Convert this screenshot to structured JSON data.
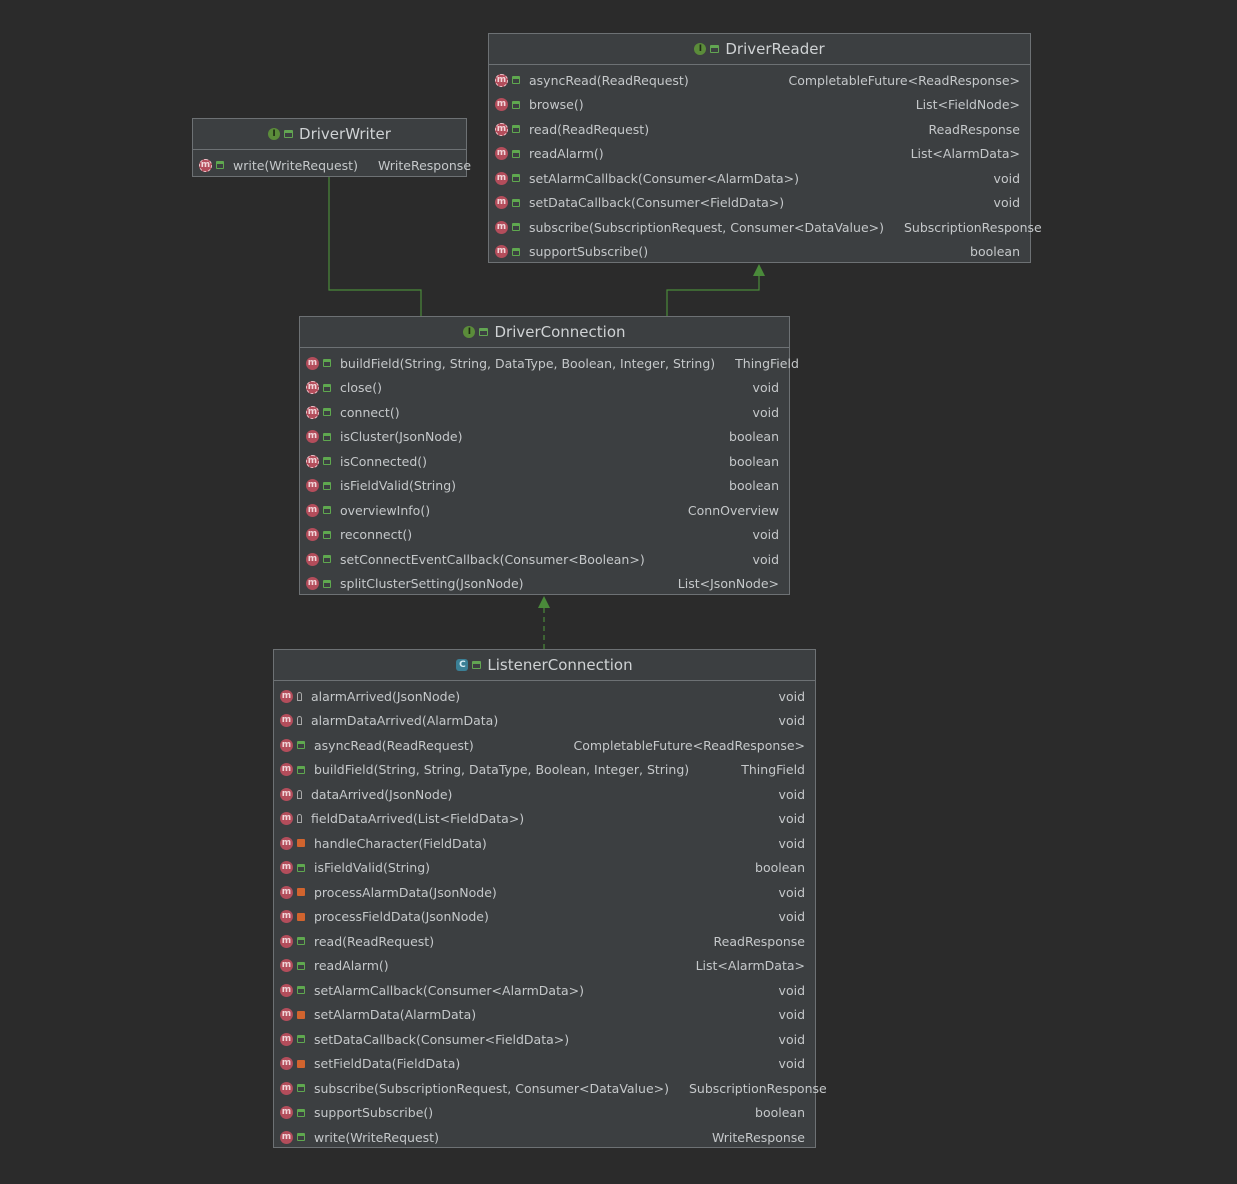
{
  "colors": {
    "background": "#2b2b2b",
    "box": "#3c3f41",
    "edge": "#4a8a3a",
    "method_icon": "#b34d5b",
    "interface_icon": "#5b8c3a",
    "class_icon": "#3a7f95"
  },
  "icons": {
    "interface": "I",
    "class": "C",
    "method": "m"
  },
  "driver_writer": {
    "title": "DriverWriter",
    "kind": "interface",
    "methods": [
      {
        "sig": "write(WriteRequest)",
        "ret": "WriteResponse",
        "vis": "public",
        "abstract": true
      }
    ]
  },
  "driver_reader": {
    "title": "DriverReader",
    "kind": "interface",
    "methods": [
      {
        "sig": "asyncRead(ReadRequest)",
        "ret": "CompletableFuture<ReadResponse>",
        "vis": "public",
        "abstract": true
      },
      {
        "sig": "browse()",
        "ret": "List<FieldNode>",
        "vis": "public",
        "abstract": false
      },
      {
        "sig": "read(ReadRequest)",
        "ret": "ReadResponse",
        "vis": "public",
        "abstract": true
      },
      {
        "sig": "readAlarm()",
        "ret": "List<AlarmData>",
        "vis": "public",
        "abstract": false
      },
      {
        "sig": "setAlarmCallback(Consumer<AlarmData>)",
        "ret": "void",
        "vis": "public",
        "abstract": false
      },
      {
        "sig": "setDataCallback(Consumer<FieldData>)",
        "ret": "void",
        "vis": "public",
        "abstract": false
      },
      {
        "sig": "subscribe(SubscriptionRequest, Consumer<DataValue>)",
        "ret": "SubscriptionResponse",
        "vis": "public",
        "abstract": false
      },
      {
        "sig": "supportSubscribe()",
        "ret": "boolean",
        "vis": "public",
        "abstract": false
      }
    ]
  },
  "driver_connection": {
    "title": "DriverConnection",
    "kind": "interface",
    "methods": [
      {
        "sig": "buildField(String, String, DataType, Boolean, Integer, String)",
        "ret": "ThingField",
        "vis": "public",
        "abstract": false
      },
      {
        "sig": "close()",
        "ret": "void",
        "vis": "public",
        "abstract": true
      },
      {
        "sig": "connect()",
        "ret": "void",
        "vis": "public",
        "abstract": true
      },
      {
        "sig": "isCluster(JsonNode)",
        "ret": "boolean",
        "vis": "public",
        "abstract": false
      },
      {
        "sig": "isConnected()",
        "ret": "boolean",
        "vis": "public",
        "abstract": true
      },
      {
        "sig": "isFieldValid(String)",
        "ret": "boolean",
        "vis": "public",
        "abstract": false
      },
      {
        "sig": "overviewInfo()",
        "ret": "ConnOverview",
        "vis": "public",
        "abstract": false
      },
      {
        "sig": "reconnect()",
        "ret": "void",
        "vis": "public",
        "abstract": false
      },
      {
        "sig": "setConnectEventCallback(Consumer<Boolean>)",
        "ret": "void",
        "vis": "public",
        "abstract": false
      },
      {
        "sig": "splitClusterSetting(JsonNode)",
        "ret": "List<JsonNode>",
        "vis": "public",
        "abstract": false
      }
    ]
  },
  "listener_connection": {
    "title": "ListenerConnection",
    "kind": "class",
    "methods": [
      {
        "sig": "alarmArrived(JsonNode)",
        "ret": "void",
        "vis": "protected",
        "abstract": false
      },
      {
        "sig": "alarmDataArrived(AlarmData)",
        "ret": "void",
        "vis": "protected",
        "abstract": false
      },
      {
        "sig": "asyncRead(ReadRequest)",
        "ret": "CompletableFuture<ReadResponse>",
        "vis": "public",
        "abstract": false
      },
      {
        "sig": "buildField(String, String, DataType, Boolean, Integer, String)",
        "ret": "ThingField",
        "vis": "public",
        "abstract": false
      },
      {
        "sig": "dataArrived(JsonNode)",
        "ret": "void",
        "vis": "protected",
        "abstract": false
      },
      {
        "sig": "fieldDataArrived(List<FieldData>)",
        "ret": "void",
        "vis": "protected",
        "abstract": false
      },
      {
        "sig": "handleCharacter(FieldData)",
        "ret": "void",
        "vis": "private",
        "abstract": false
      },
      {
        "sig": "isFieldValid(String)",
        "ret": "boolean",
        "vis": "public",
        "abstract": false
      },
      {
        "sig": "processAlarmData(JsonNode)",
        "ret": "void",
        "vis": "private",
        "abstract": false
      },
      {
        "sig": "processFieldData(JsonNode)",
        "ret": "void",
        "vis": "private",
        "abstract": false
      },
      {
        "sig": "read(ReadRequest)",
        "ret": "ReadResponse",
        "vis": "public",
        "abstract": false
      },
      {
        "sig": "readAlarm()",
        "ret": "List<AlarmData>",
        "vis": "public",
        "abstract": false
      },
      {
        "sig": "setAlarmCallback(Consumer<AlarmData>)",
        "ret": "void",
        "vis": "public",
        "abstract": false
      },
      {
        "sig": "setAlarmData(AlarmData)",
        "ret": "void",
        "vis": "private",
        "abstract": false
      },
      {
        "sig": "setDataCallback(Consumer<FieldData>)",
        "ret": "void",
        "vis": "public",
        "abstract": false
      },
      {
        "sig": "setFieldData(FieldData)",
        "ret": "void",
        "vis": "private",
        "abstract": false
      },
      {
        "sig": "subscribe(SubscriptionRequest, Consumer<DataValue>)",
        "ret": "SubscriptionResponse",
        "vis": "public",
        "abstract": false
      },
      {
        "sig": "supportSubscribe()",
        "ret": "boolean",
        "vis": "public",
        "abstract": false
      },
      {
        "sig": "write(WriteRequest)",
        "ret": "WriteResponse",
        "vis": "public",
        "abstract": false
      }
    ]
  }
}
